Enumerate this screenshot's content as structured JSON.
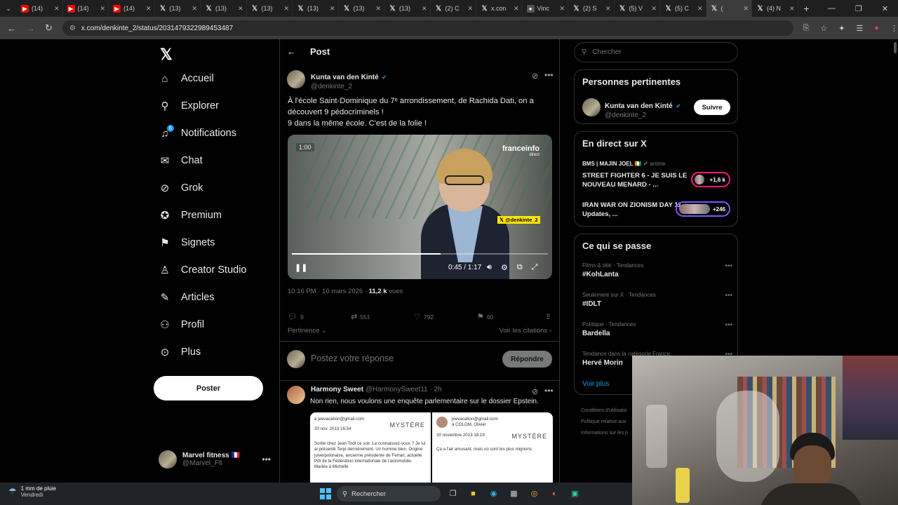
{
  "browser": {
    "tabs": [
      {
        "favicon": "youtube-icon",
        "label": "(14)"
      },
      {
        "favicon": "youtube-icon",
        "label": "(14)"
      },
      {
        "favicon": "youtube-icon",
        "label": "(14)"
      },
      {
        "favicon": "x-icon",
        "label": "(13)"
      },
      {
        "favicon": "x-icon",
        "label": "(13)"
      },
      {
        "favicon": "x-icon",
        "label": "(13)"
      },
      {
        "favicon": "x-icon",
        "label": "(13)"
      },
      {
        "favicon": "x-icon",
        "label": "(13)"
      },
      {
        "favicon": "x-icon",
        "label": "(13)"
      },
      {
        "favicon": "x-icon",
        "label": "(2) C"
      },
      {
        "favicon": "x-icon",
        "label": "x.con"
      },
      {
        "favicon": "generic-icon",
        "label": "Vinc"
      },
      {
        "favicon": "x-icon",
        "label": "(2) S"
      },
      {
        "favicon": "x-icon",
        "label": "(5) V"
      },
      {
        "favicon": "x-icon",
        "label": "(5) C"
      },
      {
        "favicon": "x-icon",
        "label": "("
      },
      {
        "favicon": "x-icon",
        "label": "(4) N"
      }
    ],
    "active_tab_index": 15,
    "url": "x.com/denkinte_2/status/2031479322989453487"
  },
  "sidebar": {
    "items": [
      {
        "icon": "home-icon",
        "glyph": "⌂",
        "label": "Accueil"
      },
      {
        "icon": "search-icon",
        "glyph": "⚲",
        "label": "Explorer"
      },
      {
        "icon": "bell-icon",
        "glyph": "♫",
        "label": "Notifications",
        "badge": "6"
      },
      {
        "icon": "mail-icon",
        "glyph": "✉",
        "label": "Chat"
      },
      {
        "icon": "grok-icon",
        "glyph": "⊘",
        "label": "Grok"
      },
      {
        "icon": "premium-icon",
        "glyph": "✪",
        "label": "Premium"
      },
      {
        "icon": "bookmark-icon",
        "glyph": "⚑",
        "label": "Signets"
      },
      {
        "icon": "creator-icon",
        "glyph": "♙",
        "label": "Creator Studio"
      },
      {
        "icon": "articles-icon",
        "glyph": "✎",
        "label": "Articles"
      },
      {
        "icon": "profile-icon",
        "glyph": "⚇",
        "label": "Profil"
      },
      {
        "icon": "more-icon",
        "glyph": "⊙",
        "label": "Plus"
      }
    ],
    "post_button": "Poster",
    "account": {
      "name": "Marvel fitness 🇫🇷",
      "handle": "@Marvel_Flt"
    }
  },
  "post": {
    "header_title": "Post",
    "author": {
      "name": "Kunta van den Kinté",
      "handle": "@denkinte_2"
    },
    "text_line1": "À l'école Saint-Dominique du 7ᵉ arrondissement, de Rachida Dati, on a découvert 9 pédocriminels !",
    "text_line2": "9 dans la même école. C'est de la folie !",
    "video": {
      "time_badge": "1:00",
      "logo": "franceinfo",
      "logo_sub": "direct",
      "tag": "𝕏 @denkinte_2",
      "time": "0:45 / 1:17",
      "progress": 0.58
    },
    "timestamp": "10:16 PM · 10 mars 2026 · ",
    "views": "11,2 k",
    "views_label": " vues",
    "stats": {
      "replies": "9",
      "reposts": "551",
      "likes": "792",
      "bookmarks": "60"
    },
    "sort_label": "Pertinence ⌄",
    "quotes_link": "Voir les citations ›",
    "reply_placeholder": "Postez votre réponse",
    "reply_button": "Répondre"
  },
  "reply": {
    "name": "Harmony Sweet",
    "handle": "@HarmonySweet11 · 2h",
    "text": "Non rien, nous voulons une enquête parlementaire sur le dossier Epstein.",
    "mail1": {
      "from": "à jeevacation@gmail.com",
      "date": "30 nov. 2013 16:54",
      "brand": "MYSTÈRE",
      "body": "Sortie chez Jean Todt ce soir. Le connaissez-vous ? Je lui ai présenté Terje dernièrement. Un homme bien. Origine juive/polonaise, ancienne présidente de Ferrari, actuelle Pdt de la Fédération internationale de l'automobile. Mariée à Michelle"
    },
    "mail2": {
      "from": "jeevacation@gmail.com",
      "to": "à COLOM, Olivier",
      "date": "30 novembre 2013 18:19",
      "brand": "MYSTÈRE",
      "body": "Ça a l'air amusant, mais où sont les plus mignons"
    }
  },
  "rail": {
    "search_placeholder": "Chercher",
    "relevant": {
      "title": "Personnes pertinentes",
      "name": "Kunta van den Kinté",
      "handle": "@denkinte_2",
      "follow": "Suivre"
    },
    "live": {
      "title": "En direct sur X",
      "host": "BMS | MAJIN JOEL 🇨🇮",
      "host_suffix": " anime.",
      "items": [
        {
          "title": "STREET FIGHTER 6 - JE SUIS LE NOUVEAU MENARD - ...",
          "count": "+1,6 k",
          "color": "#f91880"
        },
        {
          "title": "IRAN WAR ON ZIONISM DAY 11, Updates, ...",
          "count": "+246",
          "color": "#7856ff"
        }
      ]
    },
    "trending": {
      "title": "Ce qui se passe",
      "items": [
        {
          "category": "Films & télé · Tendances",
          "name": "#KohLanta"
        },
        {
          "category": "Seulement sur X · Tendances",
          "name": "#IDLT"
        },
        {
          "category": "Politique · Tendances",
          "name": "Bardella"
        },
        {
          "category": "Tendance dans la catégorie France",
          "name": "Hervé Morin"
        }
      ],
      "see_more": "Voir plus"
    },
    "footer": [
      "Conditions d'utilisatio",
      "Politique relative aux",
      "Informations sur les p"
    ]
  },
  "taskbar": {
    "weather_line1": "1 mm de pluie",
    "weather_line2": "Vendredi",
    "search_label": "Rechercher",
    "apps": [
      {
        "icon": "task-view-icon",
        "glyph": "❐",
        "color": "#cfd6dc"
      },
      {
        "icon": "file-explorer-icon",
        "glyph": "■",
        "color": "#f3c43a"
      },
      {
        "icon": "edge-icon",
        "glyph": "◉",
        "color": "#33b3e8"
      },
      {
        "icon": "store-icon",
        "glyph": "▦",
        "color": "#ccc"
      },
      {
        "icon": "chrome-icon",
        "glyph": "◎",
        "color": "#e8b63a"
      },
      {
        "icon": "firefox-icon",
        "glyph": "◐",
        "color": "#ff7139"
      },
      {
        "icon": "app-icon",
        "glyph": "▣",
        "color": "#2bd5a5"
      }
    ]
  }
}
